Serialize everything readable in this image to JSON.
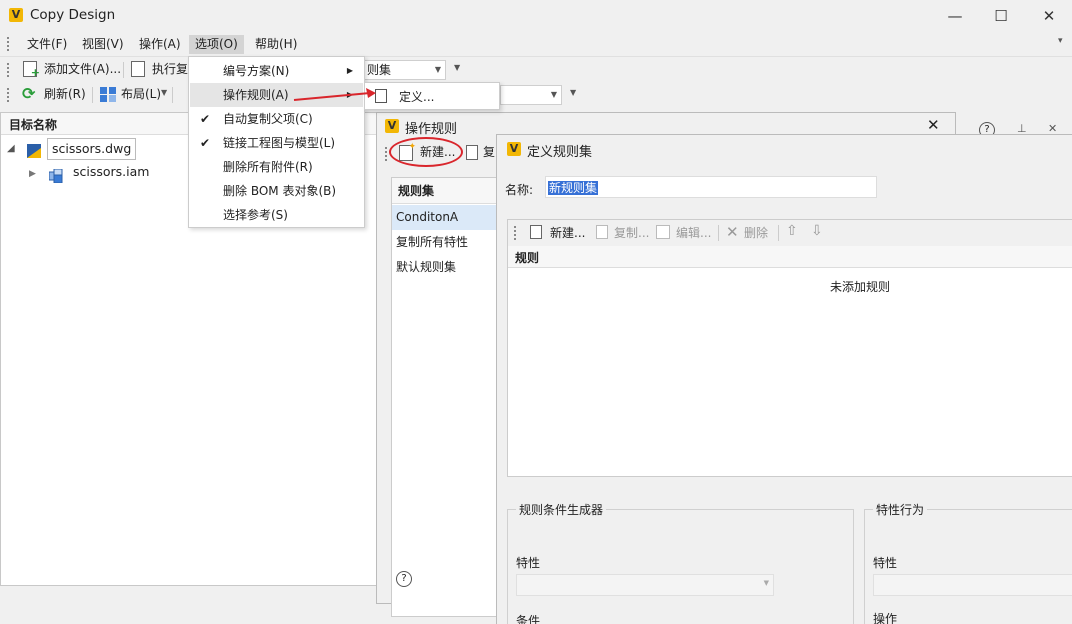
{
  "window": {
    "title": "Copy Design",
    "minimize": "—",
    "maximize": "☐",
    "close": "✕",
    "overflow": "▾"
  },
  "menubar": [
    "文件(F)",
    "视图(V)",
    "操作(A)",
    "选项(O)",
    "帮助(H)"
  ],
  "toolbar1": {
    "add_files": "添加文件(A)...",
    "execute": "执行复",
    "combo_value": "则集"
  },
  "toolbar2": {
    "refresh": "刷新(R)",
    "layout": "布局(L)"
  },
  "tree": {
    "header": "目标名称",
    "root": "scissors.dwg",
    "child": "scissors.iam"
  },
  "dropdown": {
    "items": [
      {
        "label": "编号方案(N)",
        "checked": false,
        "submenu": true
      },
      {
        "label": "操作规则(A)",
        "checked": false,
        "submenu": true
      },
      {
        "label": "自动复制父项(C)",
        "checked": true,
        "submenu": false
      },
      {
        "label": "链接工程图与模型(L)",
        "checked": true,
        "submenu": false
      },
      {
        "label": "删除所有附件(R)",
        "checked": false,
        "submenu": false
      },
      {
        "label": "删除 BOM 表对象(B)",
        "checked": false,
        "submenu": false
      },
      {
        "label": "选择参考(S)",
        "checked": false,
        "submenu": false
      }
    ],
    "submenu_item": "定义..."
  },
  "rules_dialog": {
    "title": "操作规则",
    "new_button": "新建...",
    "copy_button": "复",
    "list_header": "规则集",
    "list_items": [
      "ConditonA",
      "复制所有特性",
      "默认规则集"
    ],
    "help": "?"
  },
  "define_dialog": {
    "title": "定义规则集",
    "name_label": "名称:",
    "name_value": "新规则集",
    "tools": {
      "new": "新建...",
      "copy": "复制...",
      "edit": "编辑...",
      "delete": "删除"
    },
    "rules_header": "规则",
    "empty_text": "未添加规则",
    "condition_builder": {
      "title": "规则条件生成器",
      "property_label": "特性",
      "condition_label": "条件"
    },
    "property_behavior": {
      "title": "特性行为",
      "property_label": "特性",
      "action_label": "操作"
    }
  },
  "right_panel": {
    "help": "?",
    "pin": "⊥",
    "close": "✕"
  },
  "colors": {
    "accent": "#f2b705",
    "selection": "#3670d6",
    "annotation": "#d9262c"
  }
}
